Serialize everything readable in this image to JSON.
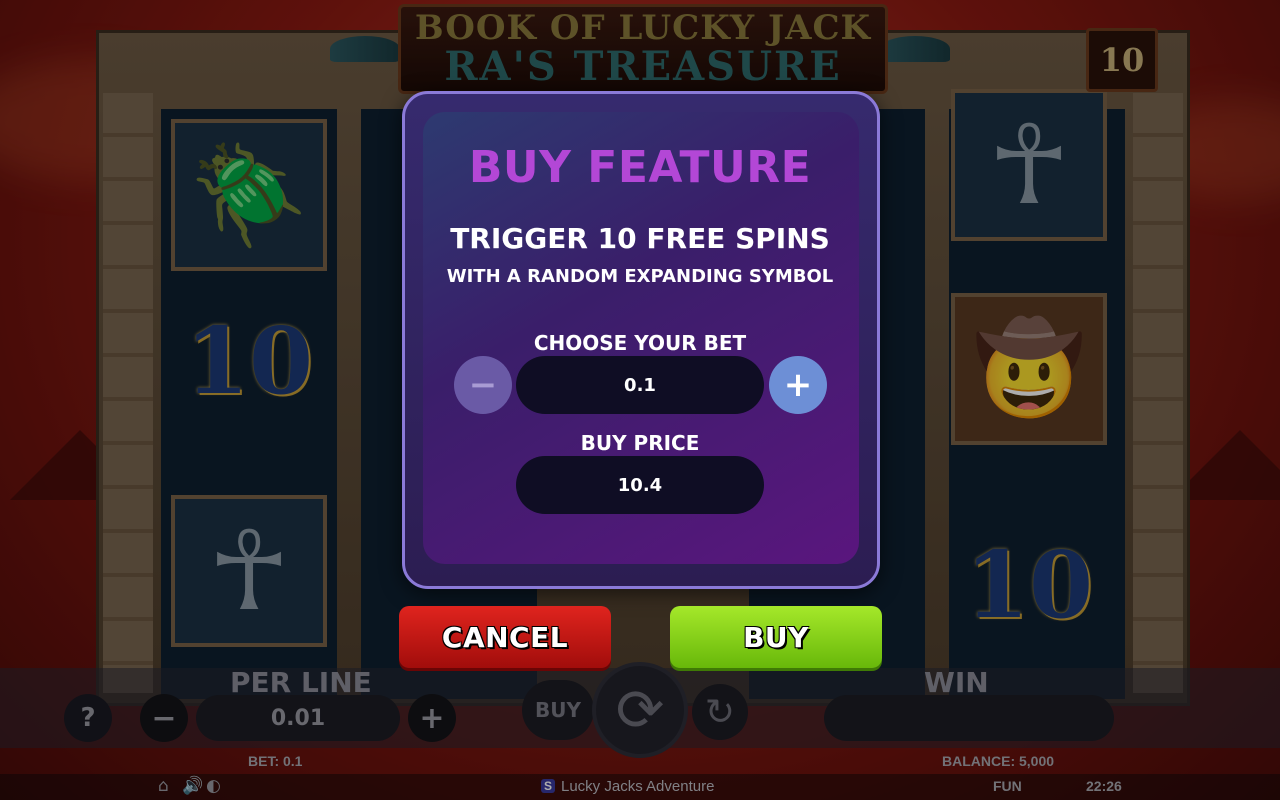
{
  "game": {
    "title_line1": "BOOK OF LUCKY JACK",
    "title_line2": "RA'S TREASURE",
    "free_spins_counter": "10"
  },
  "reels": {
    "symbols": [
      "scarab",
      "ten",
      "ankh",
      "ankh",
      "explorer",
      "ten"
    ],
    "ten_label": "10"
  },
  "dialog": {
    "title": "BUY FEATURE",
    "subtitle": "TRIGGER 10 FREE SPINS",
    "description": "WITH A RANDOM EXPANDING SYMBOL",
    "choose_bet_label": "CHOOSE YOUR BET",
    "bet_value": "0.1",
    "minus_label": "−",
    "plus_label": "+",
    "buy_price_label": "BUY PRICE",
    "buy_price_value": "10.4",
    "cancel_label": "CANCEL",
    "buy_label": "BUY"
  },
  "controls": {
    "help_label": "?",
    "per_line_label": "PER LINE",
    "per_line_value": "0.01",
    "minus_label": "−",
    "plus_label": "+",
    "buy_label": "BUY",
    "win_label": "WIN"
  },
  "status": {
    "bet": "BET: 0.1",
    "balance": "BALANCE: 5,000",
    "mode": "FUN",
    "time": "22:26"
  },
  "footer": {
    "app_name": "Lucky Jacks Adventure",
    "logo": "S"
  },
  "colors": {
    "dialog_title": "#b347d6",
    "cancel": "#d01c17",
    "buy": "#8ed41a",
    "plus_button": "#6d8fd6"
  }
}
